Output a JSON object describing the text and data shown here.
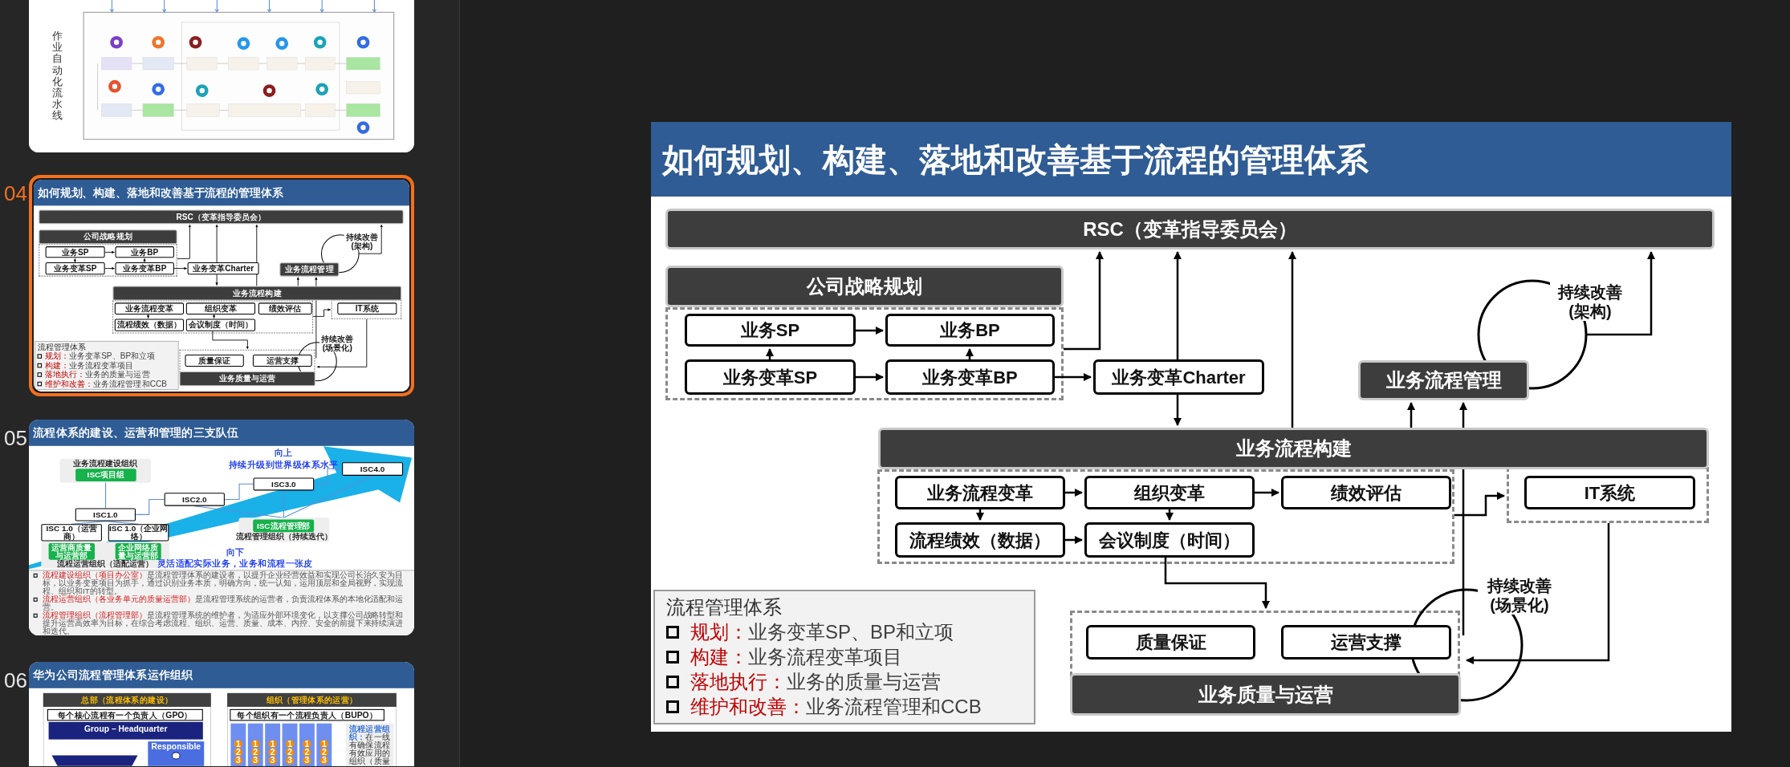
{
  "thumbnails": [
    {
      "kind": "pipeline",
      "selected": false,
      "label": "作业自动化流水线"
    },
    {
      "kind": "process",
      "number": "04",
      "selected": true,
      "slide": {
        "title": "如何规划、构建、落地和改善基于流程的管理体系",
        "nodes": [
          {
            "kind": "bar",
            "text": "RSC（变革指导委员会）"
          },
          {
            "kind": "bar",
            "text": "公司战略规划"
          },
          {
            "kind": "box",
            "text": "业务SP"
          },
          {
            "kind": "box",
            "text": "业务BP"
          },
          {
            "kind": "box",
            "text": "业务变革SP"
          },
          {
            "kind": "box",
            "text": "业务变革BP"
          },
          {
            "kind": "box",
            "text": "业务变革Charter"
          },
          {
            "kind": "bar",
            "text": "业务流程管理"
          },
          {
            "kind": "bar",
            "text": "业务流程构建"
          },
          {
            "kind": "box",
            "text": "业务流程变革"
          },
          {
            "kind": "box",
            "text": "组织变革"
          },
          {
            "kind": "box",
            "text": "绩效评估"
          },
          {
            "kind": "box",
            "text": "IT系统"
          },
          {
            "kind": "box",
            "text": "流程绩效（数据）"
          },
          {
            "kind": "box",
            "text": "会议制度（时间）"
          },
          {
            "kind": "box",
            "text": "质量保证"
          },
          {
            "kind": "box",
            "text": "运营支撑"
          },
          {
            "kind": "bar",
            "text": "业务质量与运营"
          }
        ],
        "cycles": [
          "持续改善(架构)",
          "持续改善(场景化)"
        ],
        "legend": {
          "heading": "流程管理体系",
          "items": [
            {
              "term": "规划：",
              "text": "业务变革SP、BP和立项"
            },
            {
              "term": "构建：",
              "text": "业务流程变革项目"
            },
            {
              "term": "落地执行：",
              "text": "业务的质量与运营"
            },
            {
              "term": "维护和改善：",
              "text": "业务流程管理和CCB"
            }
          ]
        }
      }
    },
    {
      "kind": "teams",
      "number": "05",
      "selected": false,
      "title": "流程体系的建设、运营和管理的三支队伍",
      "groups": [
        {
          "label": "业务流程建设组织",
          "units": [
            "ISC项目组"
          ]
        },
        {
          "label": "流程运营组织（适配运营）",
          "units": [
            "运营商质量与运营部",
            "企业网络质量与运营部"
          ]
        },
        {
          "label": "流程管理组织（持续迭代）",
          "units": [
            "ISC流程管理部"
          ]
        }
      ],
      "stages": [
        "ISC1.0",
        "ISC2.0",
        "ISC3.0",
        "ISC4.0",
        "ISC 1.0（运营商）",
        "ISC 1.0（企业网络）"
      ],
      "slogans": [
        {
          "heading": "向上",
          "text": "持续升级到世界级体系水平"
        },
        {
          "heading": "向下",
          "text": "灵活适配实际业务，业务和流程一张皮"
        }
      ],
      "notes": [
        {
          "term": "流程建设组织（项目办公室）",
          "text": "是流程管理体系的建设者，以提升企业经营效益和实现公司长治久安为目标，以业务变更项目为抓手，通过识别业务本质，明确方向，统一认知，运用顶层和全局视野，实现流程、组织和IT的转型。"
        },
        {
          "term": "流程运营组织（各业务单元的质量运营部）",
          "text": "是流程管理系统的运营者，负责流程体系的本地化适配和运营。"
        },
        {
          "term": "流程管理组织（流程管理部）",
          "text": "是流程管理系统的维护者，为适应外部环境变化，以支撑公司战略转型和提升运营高效率为目标，在综合考虑流程、组织、运营、质量、成本、内控、安全的前提下来持续演进和迭代。"
        }
      ]
    },
    {
      "kind": "org",
      "number": "06",
      "selected": false,
      "title": "华为公司流程管理体系运作组织",
      "left": {
        "heading": "总部（流程体系的建设）",
        "owner": "每个核心流程有一个负责人（GPO）",
        "group": "Group – Headquarter",
        "role": "Responsible"
      },
      "right": {
        "heading": "组织（管理体系的运营）",
        "owner": "每个组织有一个流程负责人（BUPO）",
        "columns": [
          {
            "steps": [
              "1",
              "2",
              "3"
            ]
          },
          {
            "steps": [
              "1",
              "2",
              "3"
            ]
          },
          {
            "steps": [
              "1",
              "2",
              "3"
            ]
          },
          {
            "steps": [
              "1",
              "2",
              "3"
            ]
          },
          {
            "steps": [
              "1",
              "2",
              "3"
            ]
          },
          {
            "steps": [
              "1",
              "2",
              "3"
            ]
          }
        ],
        "note_term": "流程运营组织：",
        "note_text": "在一线有确保流程有效应用的组织（质量"
      }
    }
  ],
  "slide": {
    "title": "如何规划、构建、落地和改善基于流程的管理体系",
    "nodes": [
      {
        "kind": "bar",
        "text": "RSC（变革指导委员会）"
      },
      {
        "kind": "bar",
        "text": "公司战略规划"
      },
      {
        "kind": "box",
        "text": "业务SP"
      },
      {
        "kind": "box",
        "text": "业务BP"
      },
      {
        "kind": "box",
        "text": "业务变革SP"
      },
      {
        "kind": "box",
        "text": "业务变革BP"
      },
      {
        "kind": "box",
        "text": "业务变革Charter"
      },
      {
        "kind": "bar",
        "text": "业务流程管理"
      },
      {
        "kind": "bar",
        "text": "业务流程构建"
      },
      {
        "kind": "box",
        "text": "业务流程变革"
      },
      {
        "kind": "box",
        "text": "组织变革"
      },
      {
        "kind": "box",
        "text": "绩效评估"
      },
      {
        "kind": "box",
        "text": "IT系统"
      },
      {
        "kind": "box",
        "text": "流程绩效（数据）"
      },
      {
        "kind": "box",
        "text": "会议制度（时间）"
      },
      {
        "kind": "box",
        "text": "质量保证"
      },
      {
        "kind": "box",
        "text": "运营支撑"
      },
      {
        "kind": "bar",
        "text": "业务质量与运营"
      }
    ],
    "cycles": [
      "持续改善(架构)",
      "持续改善(场景化)"
    ],
    "legend": {
      "heading": "流程管理体系",
      "items": [
        {
          "term": "规划：",
          "text": "业务变革SP、BP和立项"
        },
        {
          "term": "构建：",
          "text": "业务流程变革项目"
        },
        {
          "term": "落地执行：",
          "text": "业务的质量与运营"
        },
        {
          "term": "维护和改善：",
          "text": "业务流程管理和CCB"
        }
      ]
    }
  }
}
